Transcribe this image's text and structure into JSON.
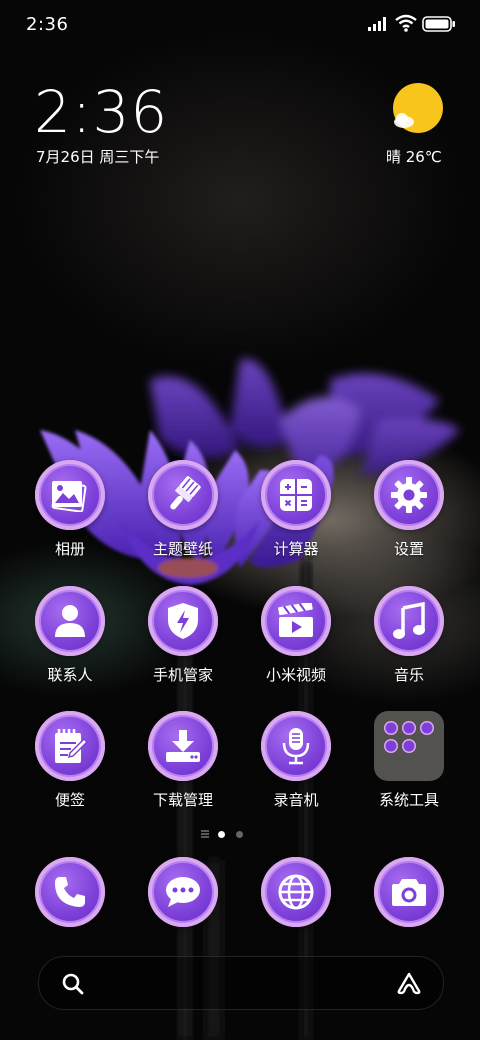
{
  "status_bar": {
    "time": "2:36",
    "icons": [
      "signal-icon",
      "wifi-icon",
      "battery-icon"
    ]
  },
  "clock_widget": {
    "time": "2:36",
    "date": "7月26日 周三下午"
  },
  "weather_widget": {
    "icon": "sun-cloud-icon",
    "text": "晴 26℃"
  },
  "apps": [
    {
      "label": "相册",
      "icon": "gallery-icon"
    },
    {
      "label": "主题壁纸",
      "icon": "theme-brush-icon"
    },
    {
      "label": "计算器",
      "icon": "calculator-icon"
    },
    {
      "label": "设置",
      "icon": "gear-icon"
    },
    {
      "label": "联系人",
      "icon": "contact-person-icon"
    },
    {
      "label": "手机管家",
      "icon": "security-shield-icon"
    },
    {
      "label": "小米视频",
      "icon": "video-clapper-icon"
    },
    {
      "label": "音乐",
      "icon": "music-note-icon"
    },
    {
      "label": "便签",
      "icon": "notes-icon"
    },
    {
      "label": "下载管理",
      "icon": "download-icon"
    },
    {
      "label": "录音机",
      "icon": "microphone-icon"
    },
    {
      "label": "系统工具",
      "icon": "folder-icon"
    }
  ],
  "page_indicator": {
    "pages": 3,
    "current": 2
  },
  "dock": [
    {
      "icon": "phone-icon"
    },
    {
      "icon": "message-bubble-icon"
    },
    {
      "icon": "browser-globe-icon"
    },
    {
      "icon": "camera-icon"
    }
  ],
  "search_bar": {
    "left_icon": "search-icon",
    "right_icon": "assistant-icon"
  },
  "colors": {
    "icon_purple": "#7c3fd8",
    "icon_ring": "#d9a8ee",
    "weather_sun": "#f7c51c"
  }
}
